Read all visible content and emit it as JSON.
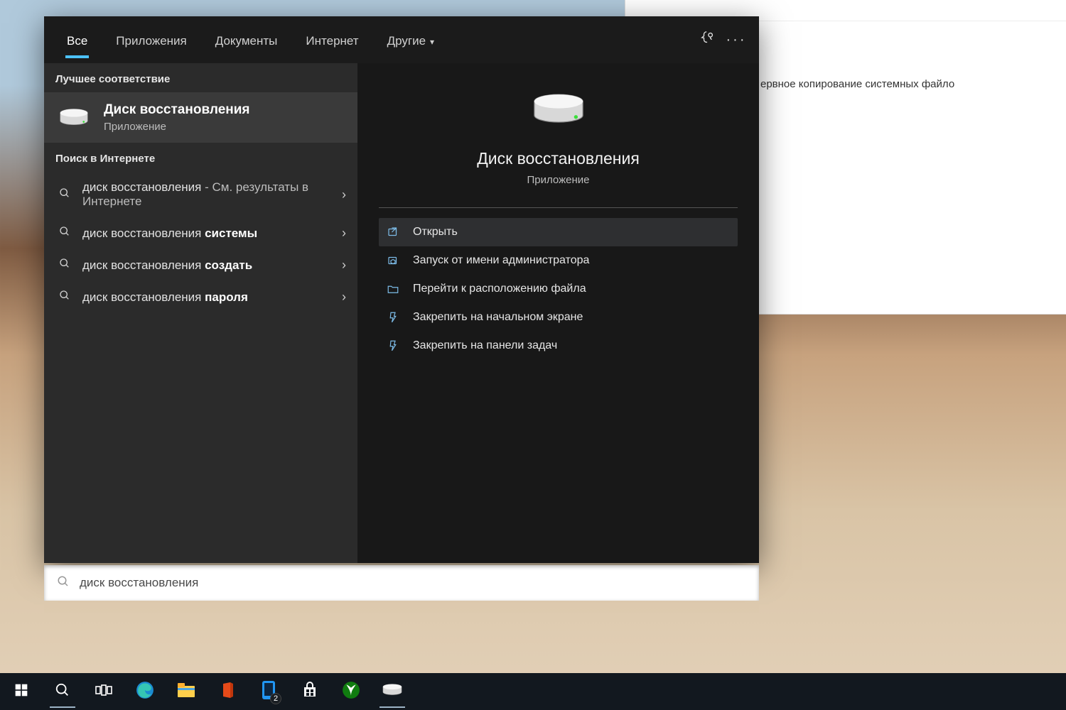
{
  "bgwin": {
    "text": "ервное копирование системных файло"
  },
  "tabs": [
    {
      "label": "Все",
      "active": true,
      "dropdown": false
    },
    {
      "label": "Приложения",
      "active": false,
      "dropdown": false
    },
    {
      "label": "Документы",
      "active": false,
      "dropdown": false
    },
    {
      "label": "Интернет",
      "active": false,
      "dropdown": false
    },
    {
      "label": "Другие",
      "active": false,
      "dropdown": true
    }
  ],
  "left": {
    "best_match_header": "Лучшее соответствие",
    "best_match": {
      "title": "Диск восстановления",
      "subtitle": "Приложение"
    },
    "web_header": "Поиск в Интернете",
    "web_items": [
      {
        "pre": "диск восстановления",
        "bold": "",
        "suffix": " - См. результаты в Интернете"
      },
      {
        "pre": "диск восстановления ",
        "bold": "системы",
        "suffix": ""
      },
      {
        "pre": "диск восстановления ",
        "bold": "создать",
        "suffix": ""
      },
      {
        "pre": "диск восстановления ",
        "bold": "пароля",
        "suffix": ""
      }
    ]
  },
  "right": {
    "title": "Диск восстановления",
    "subtitle": "Приложение",
    "actions": [
      {
        "label": "Открыть",
        "icon": "open",
        "selected": true
      },
      {
        "label": "Запуск от имени администратора",
        "icon": "admin",
        "selected": false
      },
      {
        "label": "Перейти к расположению файла",
        "icon": "folder",
        "selected": false
      },
      {
        "label": "Закрепить на начальном экране",
        "icon": "pin-start",
        "selected": false
      },
      {
        "label": "Закрепить на панели задач",
        "icon": "pin-task",
        "selected": false
      }
    ]
  },
  "search": {
    "value": "диск восстановления"
  },
  "taskbar": {
    "items": [
      {
        "name": "start",
        "active": false
      },
      {
        "name": "search",
        "active": true
      },
      {
        "name": "taskview",
        "active": false
      },
      {
        "name": "edge",
        "active": false
      },
      {
        "name": "explorer",
        "active": false
      },
      {
        "name": "office",
        "active": false
      },
      {
        "name": "phone",
        "active": false,
        "badge": "2"
      },
      {
        "name": "store",
        "active": false
      },
      {
        "name": "xbox",
        "active": false
      },
      {
        "name": "recovery-drive",
        "active": true
      }
    ]
  }
}
